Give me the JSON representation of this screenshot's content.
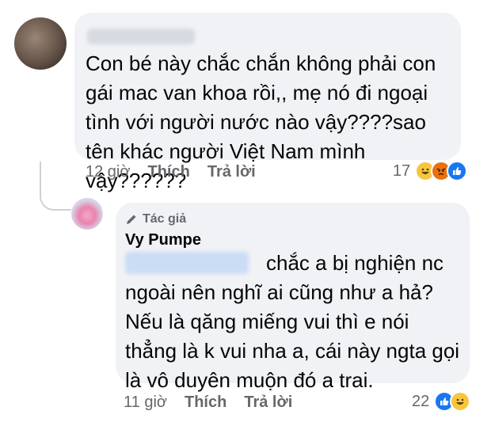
{
  "comment1": {
    "text": "Con bé này chắc chắn không phải con gái mac van khoa rồi,, mẹ nó đi ngoại tình với người nước nào vậy????sao tên khác người Việt Nam mình vậy??????",
    "time": "12 giờ",
    "like_label": "Thích",
    "reply_label": "Trả lời",
    "reaction_count": "17",
    "reactions": [
      "haha-icon",
      "angry-icon",
      "like-icon"
    ]
  },
  "comment2": {
    "badge": "Tác giả",
    "author": "Vy Pumpe",
    "text_first": "chắc a bị nghiện nc",
    "text_rest": "ngoài nên nghĩ ai cũng như a hả? Nếu là qăng miếng vui thì e nói thẳng là k vui nha a, cái này ngta gọi là vô duyên muộn đó a trai.",
    "time": "11 giờ",
    "like_label": "Thích",
    "reply_label": "Trả lời",
    "reaction_count": "22",
    "reactions": [
      "like-icon",
      "haha-icon"
    ]
  },
  "colors": {
    "bubble": "#f0f2f5",
    "meta_text": "#65676b",
    "like_blue": "#1877f2",
    "haha_yellow": "#f7c63d",
    "angry_orange": "#e9710f"
  }
}
